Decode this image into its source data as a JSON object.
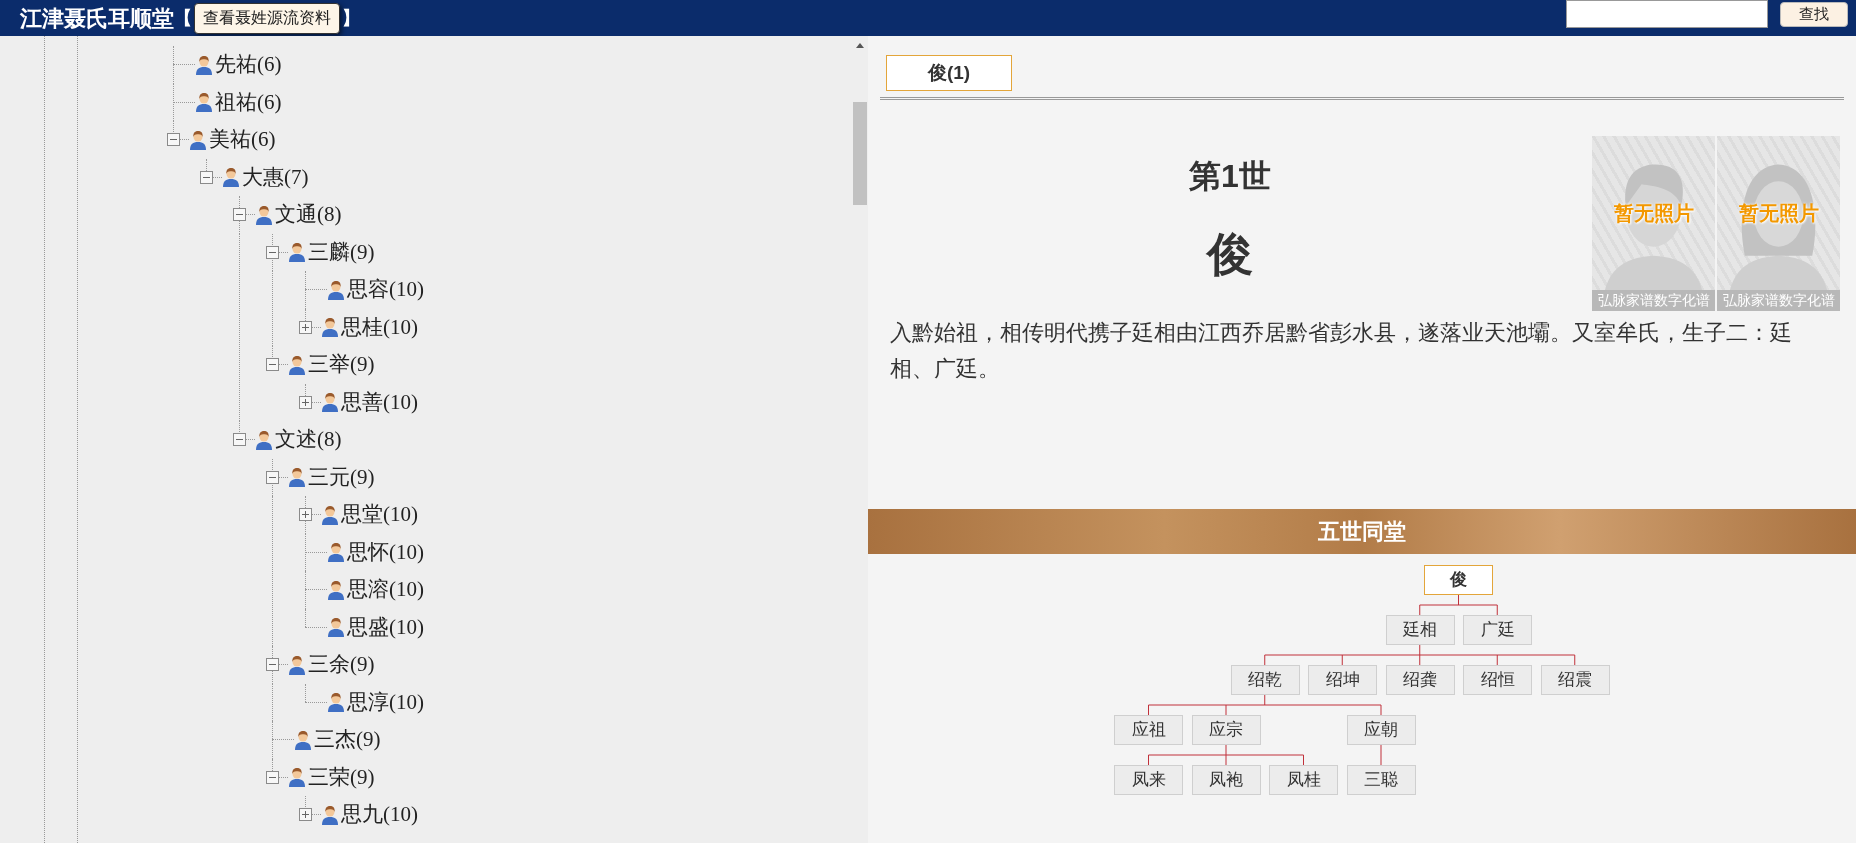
{
  "header": {
    "title": "江津聂氏耳顺堂",
    "bracket_open": "【",
    "bracket_close": "】",
    "tooltip": "查看聂姓源流资料",
    "search_button": "查找"
  },
  "tree": [
    {
      "name": "先祐(6)",
      "kind": "leaf"
    },
    {
      "name": "祖祐(6)",
      "kind": "leaf"
    },
    {
      "name": "美祐(6)",
      "kind": "branch",
      "expanded": true,
      "children": [
        {
          "name": "大惠(7)",
          "kind": "branch",
          "expanded": true,
          "children": [
            {
              "name": "文通(8)",
              "kind": "branch",
              "expanded": true,
              "children": [
                {
                  "name": "三麟(9)",
                  "kind": "branch",
                  "expanded": true,
                  "children": [
                    {
                      "name": "思容(10)",
                      "kind": "leaf"
                    },
                    {
                      "name": "思桂(10)",
                      "kind": "branch",
                      "expanded": false
                    }
                  ]
                },
                {
                  "name": "三举(9)",
                  "kind": "branch",
                  "expanded": true,
                  "children": [
                    {
                      "name": "思善(10)",
                      "kind": "branch",
                      "expanded": false
                    }
                  ]
                }
              ]
            },
            {
              "name": "文述(8)",
              "kind": "branch",
              "expanded": true,
              "children": [
                {
                  "name": "三元(9)",
                  "kind": "branch",
                  "expanded": true,
                  "children": [
                    {
                      "name": "思堂(10)",
                      "kind": "branch",
                      "expanded": false
                    },
                    {
                      "name": "思怀(10)",
                      "kind": "leaf"
                    },
                    {
                      "name": "思溶(10)",
                      "kind": "leaf"
                    },
                    {
                      "name": "思盛(10)",
                      "kind": "leaf"
                    }
                  ]
                },
                {
                  "name": "三余(9)",
                  "kind": "branch",
                  "expanded": true,
                  "children": [
                    {
                      "name": "思淳(10)",
                      "kind": "leaf"
                    }
                  ]
                },
                {
                  "name": "三杰(9)",
                  "kind": "leaf"
                },
                {
                  "name": "三荣(9)",
                  "kind": "branch",
                  "expanded": true,
                  "children": [
                    {
                      "name": "思九(10)",
                      "kind": "branch",
                      "expanded": false
                    }
                  ]
                }
              ]
            }
          ]
        }
      ]
    }
  ],
  "tabs": [
    {
      "label": "俊(1)",
      "selected": true
    }
  ],
  "person": {
    "generation": "第1世",
    "name": "俊",
    "bio": "入黔始祖，相传明代携子廷相由江西乔居黔省彭水县，遂落业天池壩。又室牟氏，生子二：廷相、广廷。"
  },
  "photos": [
    {
      "kind": "male",
      "label": "暂无照片",
      "caption": "弘脉家谱数字化谱"
    },
    {
      "kind": "female",
      "label": "暂无照片",
      "caption": "弘脉家谱数字化谱"
    }
  ],
  "family_chart": {
    "title": "五世同堂",
    "root": {
      "name": "俊",
      "selected": true,
      "children": [
        {
          "name": "廷相",
          "selected": false,
          "children": [
            {
              "name": "绍乾",
              "selected": false,
              "children": [
                {
                  "name": "应祖",
                  "selected": false
                },
                {
                  "name": "应宗",
                  "selected": false,
                  "children": [
                    {
                      "name": "凤来",
                      "selected": false
                    },
                    {
                      "name": "凤袍",
                      "selected": false
                    },
                    {
                      "name": "凤桂",
                      "selected": false
                    }
                  ]
                },
                {
                  "name": "应朝",
                  "selected": false,
                  "children": [
                    {
                      "name": "三聪",
                      "selected": false
                    }
                  ]
                }
              ]
            },
            {
              "name": "绍坤",
              "selected": false
            },
            {
              "name": "绍龚",
              "selected": false
            },
            {
              "name": "绍恒",
              "selected": false
            },
            {
              "name": "绍震",
              "selected": false
            }
          ]
        },
        {
          "name": "广廷",
          "selected": false
        }
      ]
    }
  }
}
